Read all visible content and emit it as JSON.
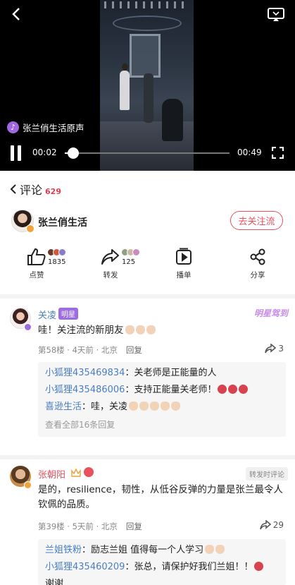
{
  "video": {
    "sound_label": "张兰俏生活原声",
    "time_current": "00:02",
    "time_total": "00:49",
    "progress": 0.05
  },
  "comments_header": {
    "title": "评论",
    "count": "629"
  },
  "author": {
    "name": "张兰俏生活",
    "follow_label": "去关注流"
  },
  "actions": {
    "like": {
      "label": "点赞",
      "count": "1835"
    },
    "repost": {
      "label": "转发",
      "count": "125"
    },
    "playlist": {
      "label": "播单"
    },
    "share": {
      "label": "分享"
    }
  },
  "comments": [
    {
      "user": "关凌",
      "tag": "明星",
      "badge": "明星驾到",
      "text": "哇！关注流的新朋友",
      "meta": "第58楼 · 4天前 · 北京",
      "reply_label": "回复",
      "shares": "3",
      "replies": [
        {
          "user": "小狐狸435469834",
          "text": "：关老师是正能量的人"
        },
        {
          "user": "小狐狸435486006",
          "text": "：支持正能量关老师！"
        },
        {
          "user": "喜逊生活",
          "text": "：哇，关凌"
        }
      ],
      "see_all": "查看全部16条回复"
    },
    {
      "user": "张朝阳",
      "hot_tag": "转发时评论",
      "text": "是的，resilience，韧性，从低谷反弹的力量是张兰最令人钦佩的品质。",
      "meta": "第39楼 · 5天前 · 北京",
      "reply_label": "回复",
      "shares": "29",
      "replies": [
        {
          "user": "兰姐铁粉",
          "text": "：励志兰姐 值得每一个人学习"
        },
        {
          "user": "小狐狸435460209",
          "text": "：张总，请保护好我们兰姐！！"
        }
      ],
      "reply_overflow": "谢谢"
    }
  ],
  "colors": {
    "accent_red": "#e8525f",
    "link_blue": "#4a7fc1",
    "star_purple": "#9b6de0"
  }
}
